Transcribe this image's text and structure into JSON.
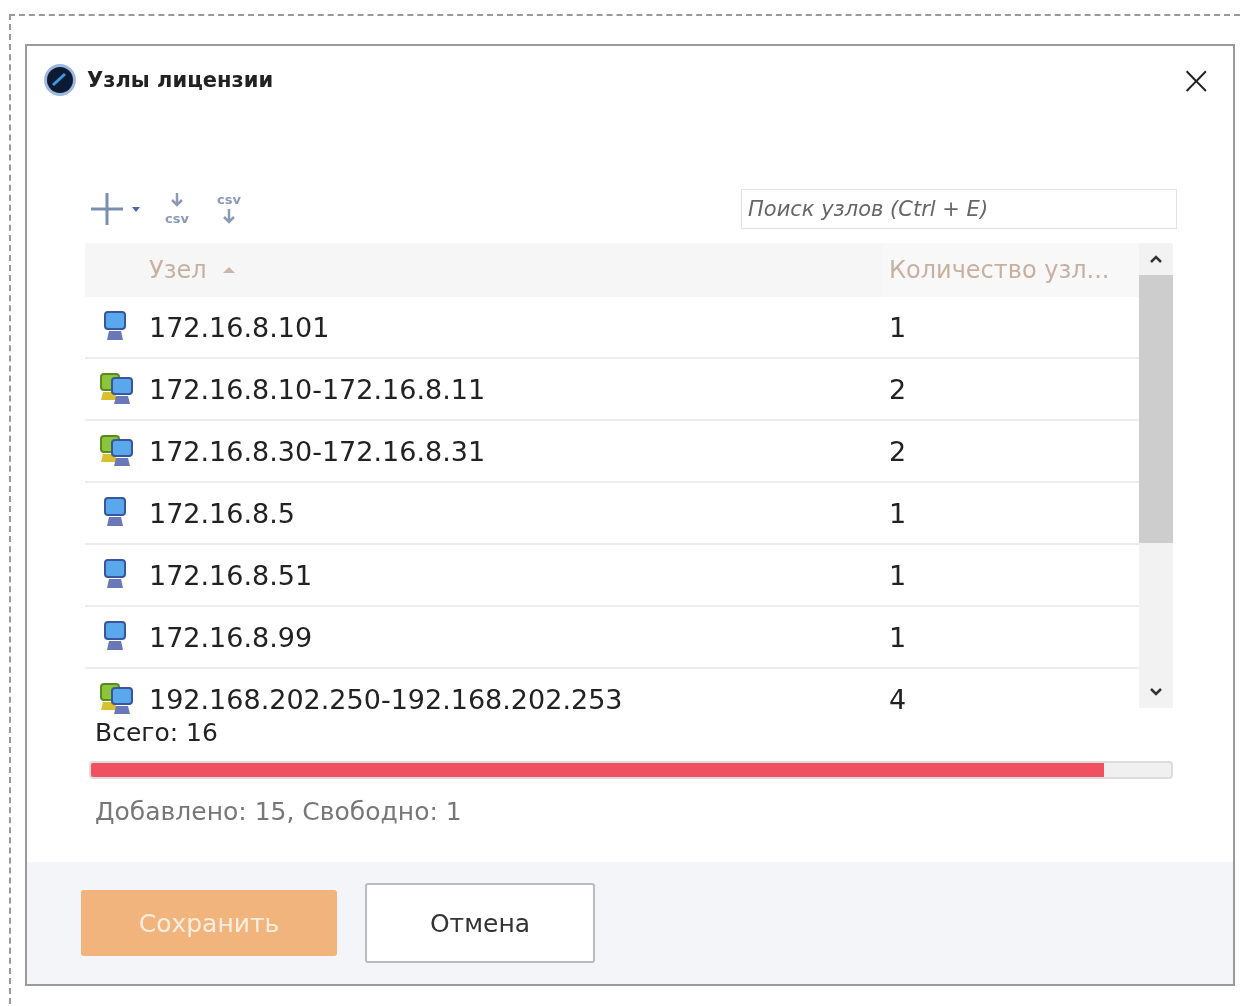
{
  "window": {
    "title": "Узлы лицензии",
    "close": "×"
  },
  "toolbar": {
    "import_label": "csv",
    "export_label": "csv",
    "search": {
      "placeholder": "Поиск узлов (Ctrl + E)"
    }
  },
  "table": {
    "columns": [
      {
        "label": "Узел",
        "sorted": true
      },
      {
        "label": "Количество узл...",
        "sorted": false
      }
    ],
    "rows": [
      {
        "kind": "single",
        "host": "172.16.8.101",
        "count": "1"
      },
      {
        "kind": "range",
        "host": "172.16.8.10-172.16.8.11",
        "count": "2"
      },
      {
        "kind": "range",
        "host": "172.16.8.30-172.16.8.31",
        "count": "2"
      },
      {
        "kind": "single",
        "host": "172.16.8.5",
        "count": "1"
      },
      {
        "kind": "single",
        "host": "172.16.8.51",
        "count": "1"
      },
      {
        "kind": "single",
        "host": "172.16.8.99",
        "count": "1"
      },
      {
        "kind": "range",
        "host": "192.168.202.250-192.168.202.253",
        "count": "4"
      }
    ]
  },
  "total": "Всего: 16",
  "usage": {
    "level": 0.9375,
    "text": "Добавлено: 15, Свободно: 1"
  },
  "buttons": [
    {
      "label": "Сохранить",
      "kind": "primary",
      "disabled": true
    },
    {
      "label": "Отмена",
      "kind": "secondary",
      "disabled": false
    }
  ]
}
